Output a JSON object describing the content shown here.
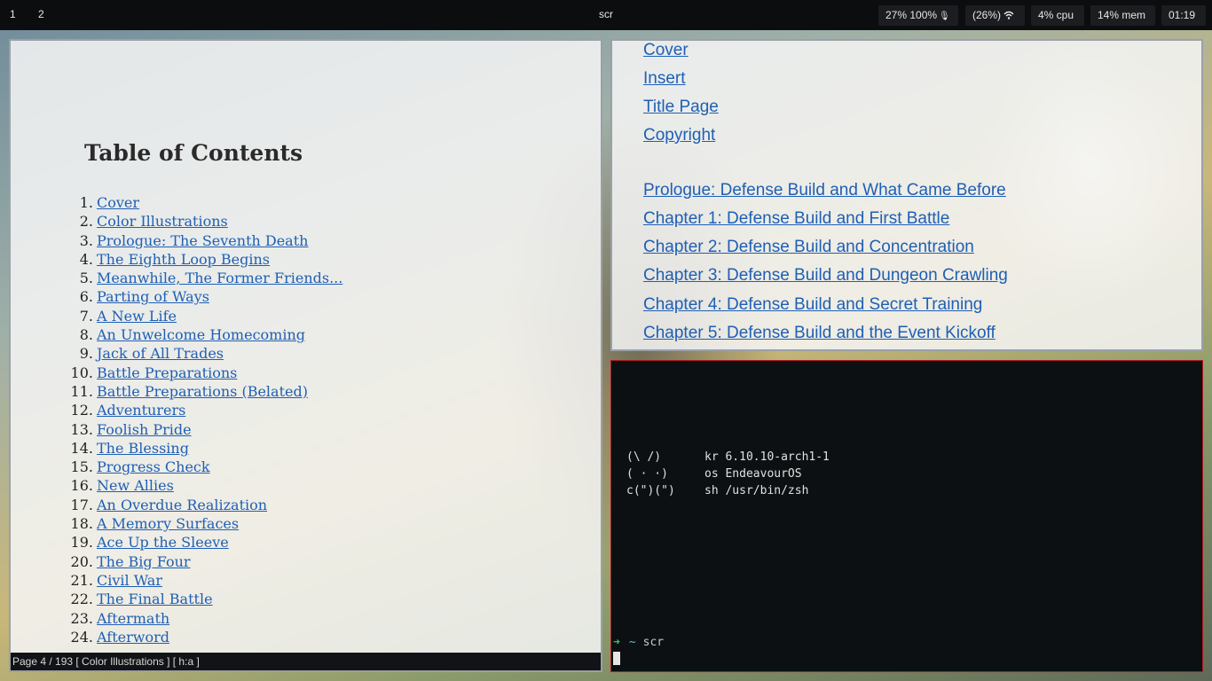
{
  "topbar": {
    "workspaces": [
      "1",
      "2"
    ],
    "title": "scr",
    "volume_battery": "27%  100%",
    "wifi": "(26%)",
    "cpu": "4% cpu",
    "mem": "14% mem",
    "clock": "01:19",
    "icons": {
      "mic": "microphone-icon",
      "wifi": "wifi-icon"
    }
  },
  "reader": {
    "heading": "Table of Contents",
    "entries": [
      {
        "num": "1.",
        "title": "Cover"
      },
      {
        "num": "2.",
        "title": "Color Illustrations"
      },
      {
        "num": "3.",
        "title": "Prologue: The Seventh Death"
      },
      {
        "num": "4.",
        "title": "The Eighth Loop Begins"
      },
      {
        "num": "5.",
        "title": "Meanwhile, The Former Friends..."
      },
      {
        "num": "6.",
        "title": "Parting of Ways"
      },
      {
        "num": "7.",
        "title": "A New Life"
      },
      {
        "num": "8.",
        "title": "An Unwelcome Homecoming"
      },
      {
        "num": "9.",
        "title": "Jack of All Trades"
      },
      {
        "num": "10.",
        "title": "Battle Preparations"
      },
      {
        "num": "11.",
        "title": "Battle Preparations (Belated)"
      },
      {
        "num": "12.",
        "title": "Adventurers"
      },
      {
        "num": "13.",
        "title": "Foolish Pride"
      },
      {
        "num": "14.",
        "title": "The Blessing"
      },
      {
        "num": "15.",
        "title": "Progress Check"
      },
      {
        "num": "16.",
        "title": "New Allies"
      },
      {
        "num": "17.",
        "title": "An Overdue Realization"
      },
      {
        "num": "18.",
        "title": "A Memory Surfaces"
      },
      {
        "num": "19.",
        "title": "Ace Up the Sleeve"
      },
      {
        "num": "20.",
        "title": "The Big Four"
      },
      {
        "num": "21.",
        "title": "Civil War"
      },
      {
        "num": "22.",
        "title": "The Final Battle"
      },
      {
        "num": "23.",
        "title": "Aftermath"
      },
      {
        "num": "24.",
        "title": "Afterword"
      }
    ],
    "status": "Page 4 / 193 [ Color Illustrations ]  [ h:a ]"
  },
  "pane2": {
    "links_front": [
      "Cover",
      "Insert",
      "Title Page",
      "Copyright"
    ],
    "links_chapters": [
      "Prologue: Defense Build and What Came Before",
      "Chapter 1: Defense Build and First Battle",
      "Chapter 2: Defense Build and Concentration",
      "Chapter 3: Defense Build and Dungeon Crawling",
      "Chapter 4: Defense Build and Secret Training",
      "Chapter 5: Defense Build and the Event Kickoff"
    ]
  },
  "terminal": {
    "fetch": [
      {
        "art": "(\\ /)",
        "info": "kr 6.10.10-arch1-1"
      },
      {
        "art": "( · ·)",
        "info": "os EndeavourOS"
      },
      {
        "art": "c(\")(\")",
        "info": "sh /usr/bin/zsh"
      }
    ],
    "prompt_arrow": "➜",
    "prompt_dir": "~",
    "prompt_cmd": "scr"
  },
  "colors": {
    "link": "#1f5fb4",
    "terminal_border": "#b01c24",
    "prompt_arrow": "#39c26a",
    "prompt_dir": "#4fc3d6"
  }
}
